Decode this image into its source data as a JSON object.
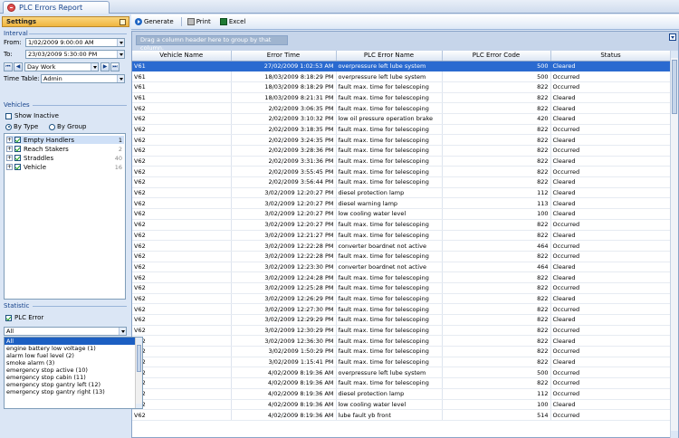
{
  "window": {
    "tab_title": "PLC Errors Report"
  },
  "settings": {
    "header": "Settings",
    "interval": {
      "title": "Interval",
      "from_label": "From:",
      "from_value": "1/02/2009   9:00:00 AM",
      "to_label": "To:",
      "to_value": "23/03/2009   5:30:00 PM",
      "shift_value": "Day Work",
      "timetable_label": "Time Table:",
      "timetable_value": "Admin"
    },
    "vehicles": {
      "title": "Vehicles",
      "show_inactive": "Show Inactive",
      "by_type": "By Type",
      "by_group": "By Group",
      "items": [
        {
          "label": "Empty Handlers",
          "count": "1"
        },
        {
          "label": "Reach Stakers",
          "count": "2"
        },
        {
          "label": "Straddles",
          "count": "40"
        },
        {
          "label": "Vehicle",
          "count": "16"
        }
      ]
    },
    "statistic": {
      "title": "Statistic",
      "plc_error": "PLC Error",
      "filter_value": "All",
      "options": [
        "All",
        "engine battery low voltage (1)",
        "alarm low fuel level (2)",
        "smoke alarm (3)",
        "emergency stop active (10)",
        "emergency stop cabin (11)",
        "emergency stop gantry left (12)",
        "emergency stop gantry right (13)"
      ]
    }
  },
  "toolbar": {
    "generate": "Generate",
    "print": "Print",
    "excel": "Excel"
  },
  "grid": {
    "group_hint": "Drag a column header here to group by that column.",
    "columns": [
      "Vehicle Name",
      "Error Time",
      "PLC Error Name",
      "PLC Error Code",
      "Status"
    ],
    "rows": [
      [
        "V61",
        "27/02/2009 1:02:53 AM",
        "overpressure left lube system",
        "500",
        "Cleared"
      ],
      [
        "V61",
        "18/03/2009 8:18:29 PM",
        "overpressure left lube system",
        "500",
        "Occurred"
      ],
      [
        "V61",
        "18/03/2009 8:18:29 PM",
        "fault max. time for telescoping",
        "822",
        "Occurred"
      ],
      [
        "V61",
        "18/03/2009 8:21:31 PM",
        "fault max. time for telescoping",
        "822",
        "Cleared"
      ],
      [
        "V62",
        "2/02/2009 3:06:35 PM",
        "fault max. time for telescoping",
        "822",
        "Cleared"
      ],
      [
        "V62",
        "2/02/2009 3:10:32 PM",
        "low oil pressure operation brake",
        "420",
        "Cleared"
      ],
      [
        "V62",
        "2/02/2009 3:18:35 PM",
        "fault max. time for telescoping",
        "822",
        "Occurred"
      ],
      [
        "V62",
        "2/02/2009 3:24:35 PM",
        "fault max. time for telescoping",
        "822",
        "Cleared"
      ],
      [
        "V62",
        "2/02/2009 3:28:36 PM",
        "fault max. time for telescoping",
        "822",
        "Occurred"
      ],
      [
        "V62",
        "2/02/2009 3:31:36 PM",
        "fault max. time for telescoping",
        "822",
        "Cleared"
      ],
      [
        "V62",
        "2/02/2009 3:55:45 PM",
        "fault max. time for telescoping",
        "822",
        "Occurred"
      ],
      [
        "V62",
        "2/02/2009 3:56:44 PM",
        "fault max. time for telescoping",
        "822",
        "Cleared"
      ],
      [
        "V62",
        "3/02/2009 12:20:27 PM",
        "diesel protection lamp",
        "112",
        "Cleared"
      ],
      [
        "V62",
        "3/02/2009 12:20:27 PM",
        "diesel warning lamp",
        "113",
        "Cleared"
      ],
      [
        "V62",
        "3/02/2009 12:20:27 PM",
        "low cooling water level",
        "100",
        "Cleared"
      ],
      [
        "V62",
        "3/02/2009 12:20:27 PM",
        "fault max. time for telescoping",
        "822",
        "Occurred"
      ],
      [
        "V62",
        "3/02/2009 12:21:27 PM",
        "fault max. time for telescoping",
        "822",
        "Cleared"
      ],
      [
        "V62",
        "3/02/2009 12:22:28 PM",
        "converter boardnet not active",
        "464",
        "Occurred"
      ],
      [
        "V62",
        "3/02/2009 12:22:28 PM",
        "fault max. time for telescoping",
        "822",
        "Occurred"
      ],
      [
        "V62",
        "3/02/2009 12:23:30 PM",
        "converter boardnet not active",
        "464",
        "Cleared"
      ],
      [
        "V62",
        "3/02/2009 12:24:28 PM",
        "fault max. time for telescoping",
        "822",
        "Cleared"
      ],
      [
        "V62",
        "3/02/2009 12:25:28 PM",
        "fault max. time for telescoping",
        "822",
        "Occurred"
      ],
      [
        "V62",
        "3/02/2009 12:26:29 PM",
        "fault max. time for telescoping",
        "822",
        "Cleared"
      ],
      [
        "V62",
        "3/02/2009 12:27:30 PM",
        "fault max. time for telescoping",
        "822",
        "Occurred"
      ],
      [
        "V62",
        "3/02/2009 12:29:29 PM",
        "fault max. time for telescoping",
        "822",
        "Cleared"
      ],
      [
        "V62",
        "3/02/2009 12:30:29 PM",
        "fault max. time for telescoping",
        "822",
        "Occurred"
      ],
      [
        "V62",
        "3/02/2009 12:36:30 PM",
        "fault max. time for telescoping",
        "822",
        "Cleared"
      ],
      [
        "V62",
        "3/02/2009 1:50:29 PM",
        "fault max. time for telescoping",
        "822",
        "Occurred"
      ],
      [
        "V62",
        "3/02/2009 1:15:41 PM",
        "fault max. time for telescoping",
        "822",
        "Cleared"
      ],
      [
        "V62",
        "4/02/2009 8:19:36 AM",
        "overpressure left lube system",
        "500",
        "Occurred"
      ],
      [
        "V62",
        "4/02/2009 8:19:36 AM",
        "fault max. time for telescoping",
        "822",
        "Occurred"
      ],
      [
        "V62",
        "4/02/2009 8:19:36 AM",
        "diesel protection lamp",
        "112",
        "Occurred"
      ],
      [
        "V62",
        "4/02/2009 8:19:36 AM",
        "low cooling water level",
        "100",
        "Cleared"
      ],
      [
        "V62",
        "4/02/2009 8:19:36 AM",
        "lube fault yb front",
        "514",
        "Occurred"
      ]
    ]
  }
}
